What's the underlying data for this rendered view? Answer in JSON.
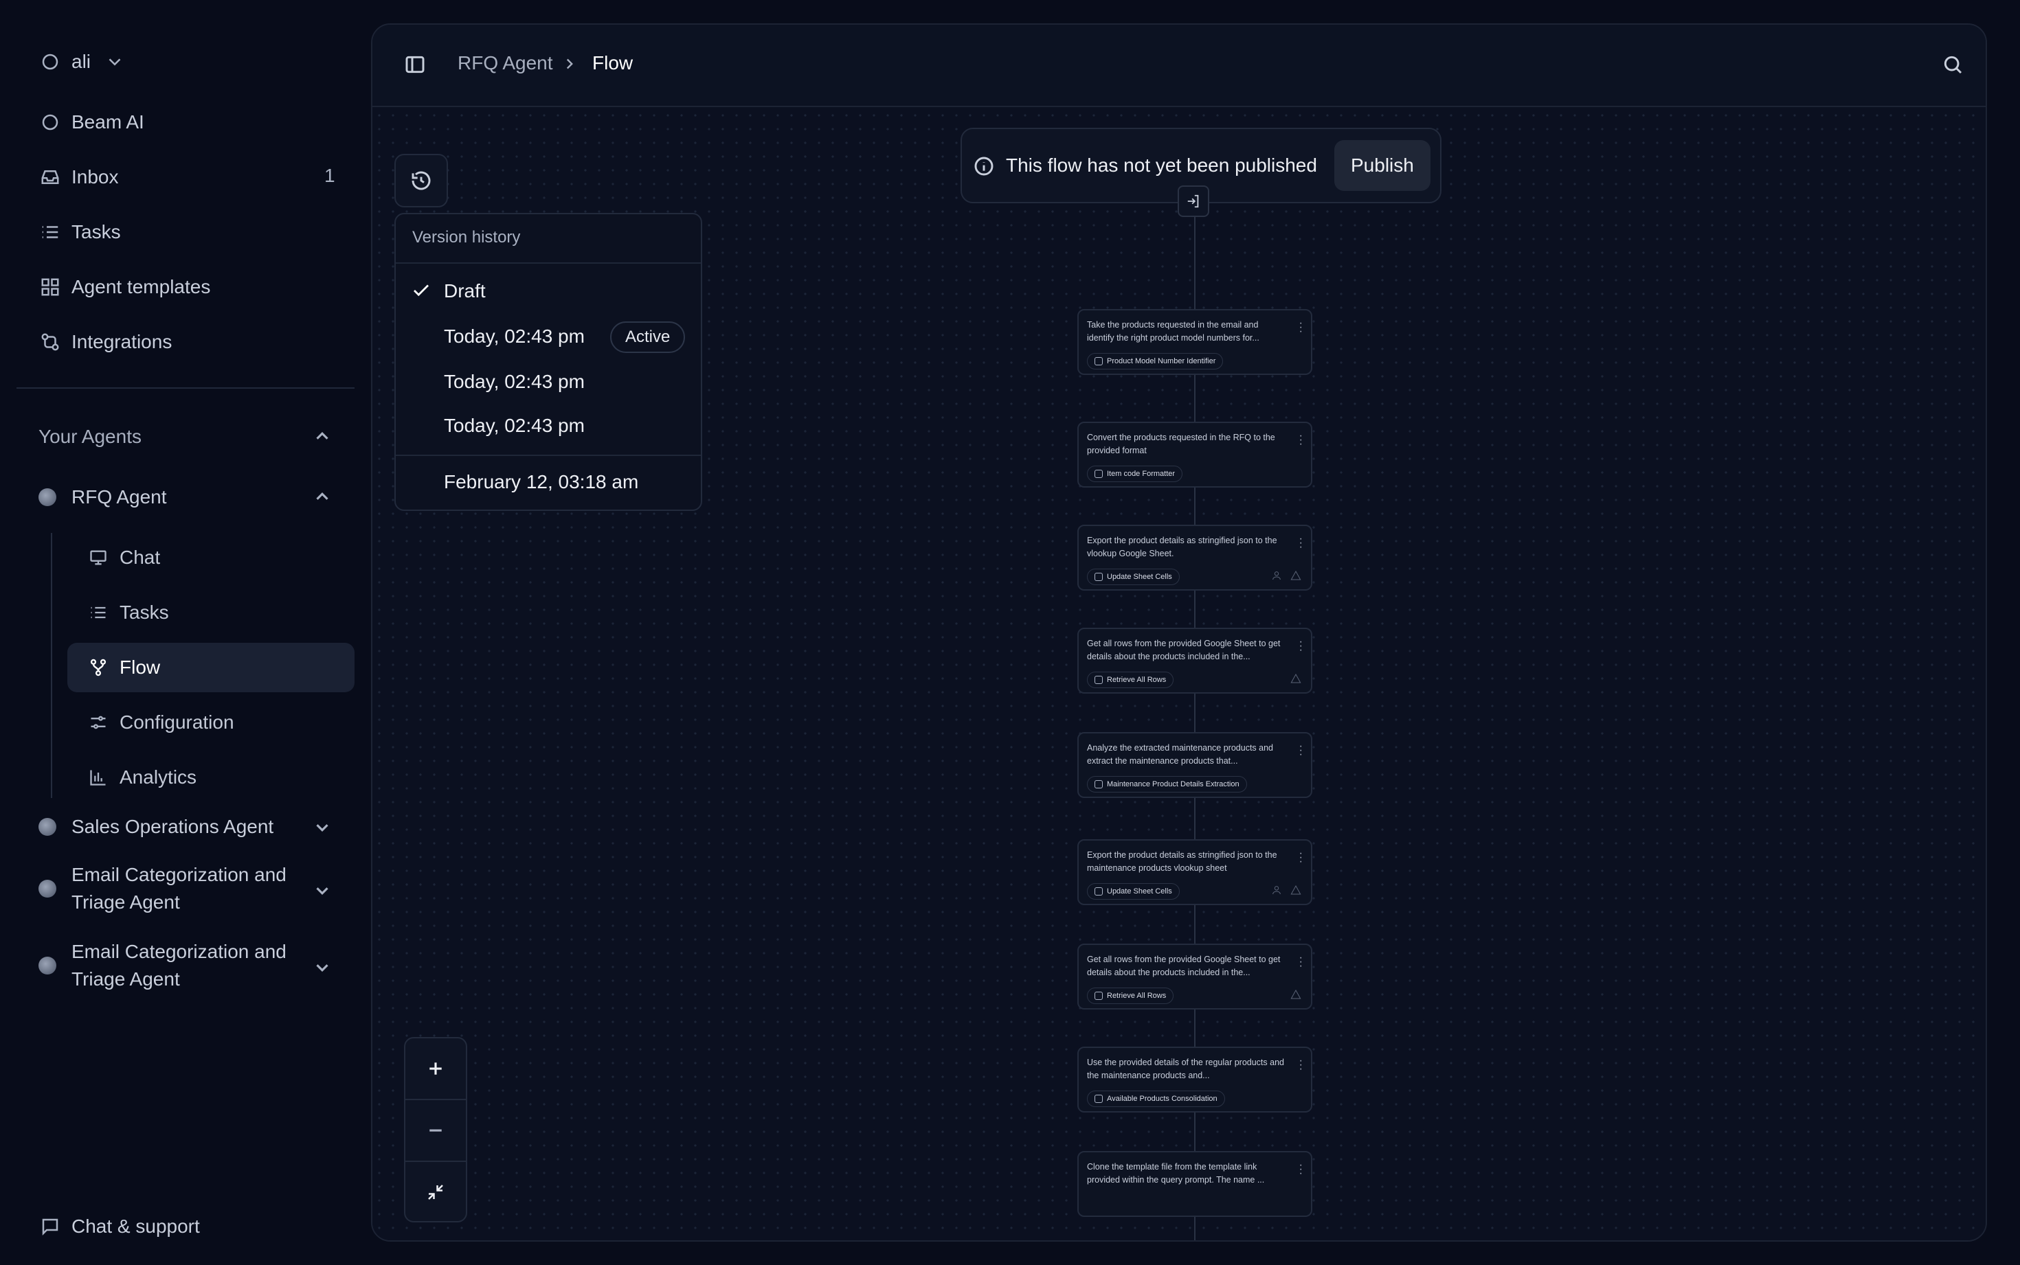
{
  "workspace": {
    "name": "ali"
  },
  "nav": {
    "beam_ai": "Beam AI",
    "inbox": "Inbox",
    "inbox_count": "1",
    "tasks": "Tasks",
    "agent_templates": "Agent templates",
    "integrations": "Integrations"
  },
  "your_agents": {
    "label": "Your Agents",
    "rfq_agent": {
      "name": "RFQ Agent",
      "sub_items": [
        "Chat",
        "Tasks",
        "Flow",
        "Configuration",
        "Analytics"
      ],
      "active_item": "Flow"
    },
    "others": [
      "Sales Operations Agent",
      "Email Categorization and Triage Agent",
      "Email Categorization and Triage Agent"
    ]
  },
  "footer": {
    "chat_support": "Chat & support"
  },
  "breadcrumb": {
    "parent": "RFQ Agent",
    "current": "Flow"
  },
  "version_history": {
    "title": "Version history",
    "draft": "Draft",
    "versions": [
      "Today, 02:43 pm",
      "Today, 02:43 pm",
      "Today, 02:43 pm"
    ],
    "active_label": "Active",
    "older": "February 12, 03:18 am"
  },
  "publish_banner": {
    "text": "This flow has not yet been published",
    "button": "Publish"
  },
  "flow_nodes": [
    {
      "text": "Take the products requested in the email and identify the right product model numbers for...",
      "tool": "Product Model Number Identifier"
    },
    {
      "text": "Convert the products requested in the RFQ to the provided format",
      "tool": "Item code Formatter"
    },
    {
      "text": "Export the product details as stringified json to the vlookup Google Sheet.",
      "tool": "Update Sheet Cells"
    },
    {
      "text": "Get all rows from the provided Google Sheet to get details about the products included in the...",
      "tool": "Retrieve All Rows"
    },
    {
      "text": "Analyze the extracted maintenance products and extract the maintenance products that...",
      "tool": "Maintenance Product Details Extraction"
    },
    {
      "text": "Export the product details as stringified json to the maintenance products vlookup sheet",
      "tool": "Update Sheet Cells"
    },
    {
      "text": "Get all rows from the provided Google Sheet to get details about the products included in the...",
      "tool": "Retrieve All Rows"
    },
    {
      "text": "Use the provided details of the regular products and the maintenance products and...",
      "tool": "Available Products Consolidation"
    },
    {
      "text": "Clone the template file from the template link provided within the query prompt. The name ...",
      "tool": ""
    }
  ]
}
